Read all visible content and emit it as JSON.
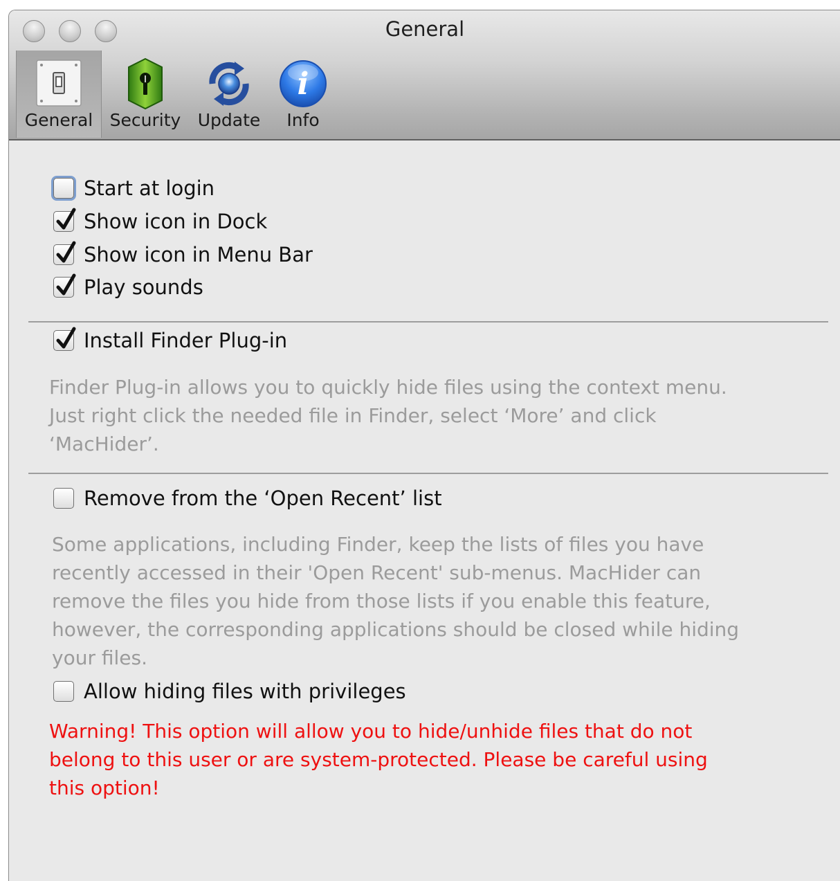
{
  "window": {
    "title": "General"
  },
  "toolbar": {
    "items": [
      {
        "label": "General",
        "icon": "switch-icon",
        "selected": true
      },
      {
        "label": "Security",
        "icon": "keyhole-shield-icon",
        "selected": false
      },
      {
        "label": "Update",
        "icon": "sync-globe-icon",
        "selected": false
      },
      {
        "label": "Info",
        "icon": "info-icon",
        "selected": false
      }
    ]
  },
  "options": {
    "start_at_login": {
      "label": "Start at login",
      "checked": false
    },
    "show_icon_dock": {
      "label": "Show icon in Dock",
      "checked": true
    },
    "show_icon_menubar": {
      "label": "Show icon in Menu Bar",
      "checked": true
    },
    "play_sounds": {
      "label": "Play sounds",
      "checked": true
    },
    "install_finder_plugin": {
      "label": "Install Finder Plug-in",
      "checked": true
    },
    "finder_plugin_description": [
      "Finder Plug-in allows you to quickly hide files using the context menu.",
      "Just right click the needed file in Finder, select ‘More’ and click",
      "‘MacHider’."
    ],
    "remove_open_recent": {
      "label": "Remove from the ‘Open Recent’ list",
      "checked": false
    },
    "open_recent_description": [
      "Some applications, including Finder, keep the lists of files you have",
      "recently accessed in their 'Open Recent' sub-menus. MacHider can",
      "remove the files you hide from those lists if you enable this feature,",
      "however, the corresponding applications should be closed while hiding",
      "your files."
    ],
    "allow_privileges": {
      "label": "Allow hiding files with privileges",
      "checked": false
    },
    "privileges_warning": [
      "Warning! This option will allow you to hide/unhide files that do not",
      "belong to this user or are system-protected. Please be careful using",
      "this option!"
    ]
  },
  "colors": {
    "description_text": "#9b9b9b",
    "warning_text": "#ee1111",
    "window_background": "#e9e9e9"
  }
}
